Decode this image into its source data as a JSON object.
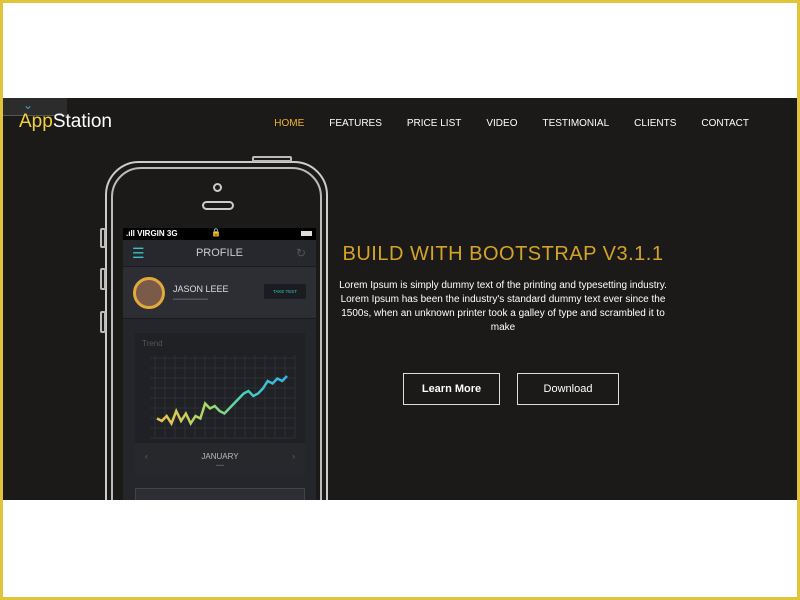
{
  "brand": {
    "logo_part1": "App",
    "logo_part2": "Station",
    "accent": "#f0d23c"
  },
  "nav": [
    {
      "label": "HOME",
      "active": true
    },
    {
      "label": "FEATURES"
    },
    {
      "label": "PRICE LIST"
    },
    {
      "label": "VIDEO"
    },
    {
      "label": "TESTIMONIAL"
    },
    {
      "label": "CLIENTS"
    },
    {
      "label": "CONTACT"
    }
  ],
  "phone": {
    "carrier": "VIRGIN",
    "network": "3G",
    "screen_title": "PROFILE",
    "user_name": "JASON LEEE",
    "take_test": "TAKE TEST",
    "chart_title": "Trend",
    "month": "JANUARY",
    "trend": [
      3,
      2,
      4,
      1,
      6,
      2,
      5,
      1,
      4,
      3,
      9,
      7,
      8,
      6,
      5,
      7,
      9,
      11,
      13,
      14,
      12,
      13,
      15,
      18,
      17,
      19,
      18,
      20
    ]
  },
  "hero": {
    "headline": "BUILD WITH BOOTSTRAP V3.1.1",
    "description": "Lorem Ipsum is simply dummy text of the printing and typesetting industry. Lorem Ipsum has been the industry's standard dummy text ever since the 1500s, when an unknown printer took a galley of type and scrambled it to make",
    "learn_more": "Learn More",
    "download": "Download"
  }
}
